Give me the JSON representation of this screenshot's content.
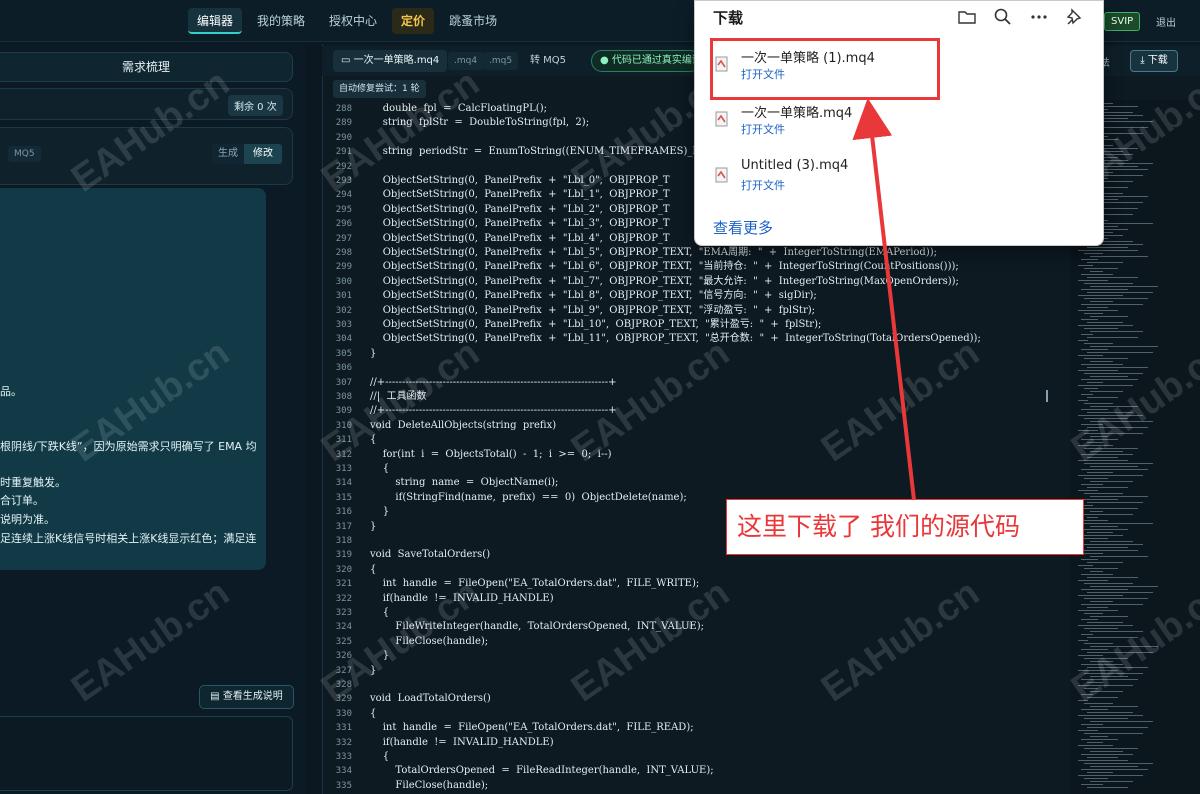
{
  "topbar": {
    "nav": [
      "编辑器",
      "我的策略",
      "授权中心",
      "定价",
      "跳蚤市场"
    ],
    "svip": "SVIP",
    "logout": "退出"
  },
  "left": {
    "title": "需求梳理",
    "remain": "剩余 0 次",
    "mq5": "MQ5",
    "gen": "生成",
    "modify": "修改",
    "notes": [
      "品。",
      "根阴线/下跌K线”，因为原始需求只明确写了 EMA 均",
      "时重复触发。",
      "合订单。",
      "说明为准。",
      "足连续上涨K线信号时相关上涨K线显示红色；满足连"
    ],
    "view_button": "查看生成说明"
  },
  "editor": {
    "file_tab": "一次一单策略.mq4",
    "ext1": ".mq4",
    "ext2": ".mq5",
    "convert": "转 MQ5",
    "passed": "代码已通过真实编译",
    "autofix": "自动修复尝试：1 轮",
    "download": "下载",
    "fa": "法",
    "lines": [
      {
        "n": "288",
        "t": "    double  fpl  =  CalcFloatingPL();"
      },
      {
        "n": "289",
        "t": "    string  fplStr  =  DoubleToString(fpl,  2);"
      },
      {
        "n": "290",
        "t": ""
      },
      {
        "n": "291",
        "t": "    string  periodStr  =  EnumToString((ENUM_TIMEFRAMES)_Pe"
      },
      {
        "n": "292",
        "t": ""
      },
      {
        "n": "293",
        "t": "    ObjectSetString(0,  PanelPrefix  +  \"Lbl_0\",  OBJPROP_T"
      },
      {
        "n": "294",
        "t": "    ObjectSetString(0,  PanelPrefix  +  \"Lbl_1\",  OBJPROP_T"
      },
      {
        "n": "295",
        "t": "    ObjectSetString(0,  PanelPrefix  +  \"Lbl_2\",  OBJPROP_T"
      },
      {
        "n": "296",
        "t": "    ObjectSetString(0,  PanelPrefix  +  \"Lbl_3\",  OBJPROP_T"
      },
      {
        "n": "297",
        "t": "    ObjectSetString(0,  PanelPrefix  +  \"Lbl_4\",  OBJPROP_T"
      },
      {
        "n": "298",
        "t": "    ObjectSetString(0,  PanelPrefix  +  \"Lbl_5\",  OBJPROP_TEXT,  \"EMA周期:  \"  +  IntegerToString(EMAPeriod));"
      },
      {
        "n": "299",
        "t": "    ObjectSetString(0,  PanelPrefix  +  \"Lbl_6\",  OBJPROP_TEXT,  \"当前持仓:  \"  +  IntegerToString(CountPositions()));"
      },
      {
        "n": "300",
        "t": "    ObjectSetString(0,  PanelPrefix  +  \"Lbl_7\",  OBJPROP_TEXT,  \"最大允许:  \"  +  IntegerToString(MaxOpenOrders));"
      },
      {
        "n": "301",
        "t": "    ObjectSetString(0,  PanelPrefix  +  \"Lbl_8\",  OBJPROP_TEXT,  \"信号方向:  \"  +  sigDir);"
      },
      {
        "n": "302",
        "t": "    ObjectSetString(0,  PanelPrefix  +  \"Lbl_9\",  OBJPROP_TEXT,  \"浮动盈亏:  \"  +  fplStr);"
      },
      {
        "n": "303",
        "t": "    ObjectSetString(0,  PanelPrefix  +  \"Lbl_10\",  OBJPROP_TEXT,  \"累计盈亏:  \"  +  fplStr);"
      },
      {
        "n": "304",
        "t": "    ObjectSetString(0,  PanelPrefix  +  \"Lbl_11\",  OBJPROP_TEXT,  \"总开仓数:  \"  +  IntegerToString(TotalOrdersOpened));"
      },
      {
        "n": "305",
        "t": "}"
      },
      {
        "n": "306",
        "t": ""
      },
      {
        "n": "307",
        "t": "//+------------------------------------------------------------------+"
      },
      {
        "n": "308",
        "t": "//|  工具函数"
      },
      {
        "n": "309",
        "t": "//+------------------------------------------------------------------+"
      },
      {
        "n": "310",
        "t": "void  DeleteAllObjects(string  prefix)"
      },
      {
        "n": "311",
        "t": "{"
      },
      {
        "n": "312",
        "t": "    for(int  i  =  ObjectsTotal()  -  1;  i  >=  0;  i--)"
      },
      {
        "n": "313",
        "t": "    {"
      },
      {
        "n": "314",
        "t": "        string  name  =  ObjectName(i);"
      },
      {
        "n": "315",
        "t": "        if(StringFind(name,  prefix)  ==  0)  ObjectDelete(name);"
      },
      {
        "n": "316",
        "t": "    }"
      },
      {
        "n": "317",
        "t": "}"
      },
      {
        "n": "318",
        "t": ""
      },
      {
        "n": "319",
        "t": "void  SaveTotalOrders()"
      },
      {
        "n": "320",
        "t": "{"
      },
      {
        "n": "321",
        "t": "    int  handle  =  FileOpen(\"EA_TotalOrders.dat\",  FILE_WRITE);"
      },
      {
        "n": "322",
        "t": "    if(handle  !=  INVALID_HANDLE)"
      },
      {
        "n": "323",
        "t": "    {"
      },
      {
        "n": "324",
        "t": "        FileWriteInteger(handle,  TotalOrdersOpened,  INT_VALUE);"
      },
      {
        "n": "325",
        "t": "        FileClose(handle);"
      },
      {
        "n": "326",
        "t": "    }"
      },
      {
        "n": "327",
        "t": "}"
      },
      {
        "n": "328",
        "t": ""
      },
      {
        "n": "329",
        "t": "void  LoadTotalOrders()"
      },
      {
        "n": "330",
        "t": "{"
      },
      {
        "n": "331",
        "t": "    int  handle  =  FileOpen(\"EA_TotalOrders.dat\",  FILE_READ);"
      },
      {
        "n": "332",
        "t": "    if(handle  !=  INVALID_HANDLE)"
      },
      {
        "n": "333",
        "t": "    {"
      },
      {
        "n": "334",
        "t": "        TotalOrdersOpened  =  FileReadInteger(handle,  INT_VALUE);"
      },
      {
        "n": "335",
        "t": "        FileClose(handle);"
      }
    ]
  },
  "downloads": {
    "title": "下载",
    "items": [
      {
        "name": "一次一单策略 (1).mq4",
        "open": "打开文件"
      },
      {
        "name": "一次一单策略.mq4",
        "open": "打开文件"
      },
      {
        "name": "Untitled (3).mq4",
        "open": "打开文件"
      }
    ],
    "see_more": "查看更多"
  },
  "annotation": {
    "callout": "这里下载了 我们的源代码",
    "color": "#e8383a"
  },
  "watermark": "EAHub.cn"
}
